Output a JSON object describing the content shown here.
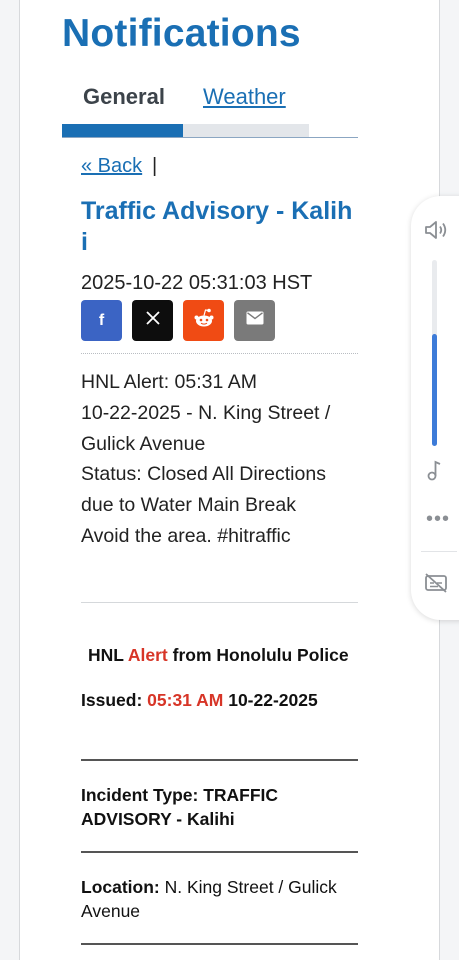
{
  "header": {
    "title": "Notifications"
  },
  "tabs": [
    {
      "label": "General",
      "active": true
    },
    {
      "label": "Weather",
      "active": false
    }
  ],
  "nav": {
    "back_label": "« Back",
    "separator": "|"
  },
  "article": {
    "title": "Traffic Advisory - Kalihi",
    "datetime": "2025-10-22 05:31:03 HST",
    "body_lines": [
      "HNL Alert: 05:31 AM",
      "10-22-2025 - N. King Street /",
      "Gulick Avenue",
      "Status: Closed All Directions",
      "due to Water Main Break",
      "Avoid the area. #hitraffic"
    ]
  },
  "share": [
    {
      "name": "facebook",
      "glyph": "f",
      "color": "#3b64c4"
    },
    {
      "name": "x",
      "glyph": "𝕏",
      "color": "#0d0d0d"
    },
    {
      "name": "reddit",
      "glyph": "reddit",
      "color": "#f04b14"
    },
    {
      "name": "email",
      "glyph": "mail",
      "color": "#7a7a7a"
    }
  ],
  "alert": {
    "prefix": "HNL",
    "highlight": "Alert",
    "suffix": "from Honolulu Police",
    "issued_label": "Issued:",
    "issued_time": "05:31 AM",
    "issued_date": "10-22-2025",
    "incident_label": "Incident Type:",
    "incident_value": "TRAFFIC ADVISORY - Kalihi",
    "location_label": "Location:",
    "location_value": "N. King Street / Gulick Avenue"
  },
  "side_toolbar": {
    "volume_level": 0.6,
    "icons": [
      "speaker-icon",
      "music-note-icon",
      "more-icon",
      "captions-off-icon"
    ]
  },
  "colors": {
    "brand_blue": "#1a6fb4",
    "alert_red": "#d73527"
  }
}
